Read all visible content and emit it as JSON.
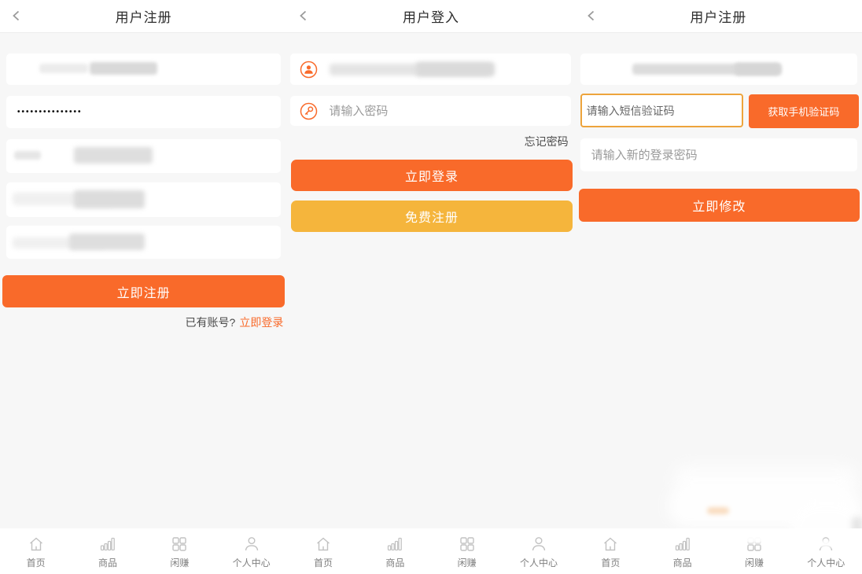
{
  "colors": {
    "accent": "#f96a2a",
    "secondary": "#f5b53c",
    "sms_input_border": "#eda43c"
  },
  "screens": {
    "register": {
      "title": "用户注册",
      "password_value": "•••••••••••••••",
      "submit_label": "立即注册",
      "footer_prefix": "已有账号?",
      "footer_link": "立即登录"
    },
    "login": {
      "title": "用户登入",
      "password_placeholder": "请输入密码",
      "forgot_link": "忘记密码",
      "login_label": "立即登录",
      "register_label": "免费注册"
    },
    "reset": {
      "title": "用户注册",
      "sms_placeholder": "请输入短信验证码",
      "get_code_label": "获取手机验证码",
      "new_password_placeholder": "请输入新的登录密码",
      "submit_label": "立即修改"
    }
  },
  "tabbar": {
    "items": [
      {
        "label": "首页",
        "icon": "home-icon"
      },
      {
        "label": "商品",
        "icon": "bar-chart-icon"
      },
      {
        "label": "闲赚",
        "icon": "grid-icon"
      },
      {
        "label": "个人中心",
        "icon": "user-icon"
      }
    ]
  }
}
